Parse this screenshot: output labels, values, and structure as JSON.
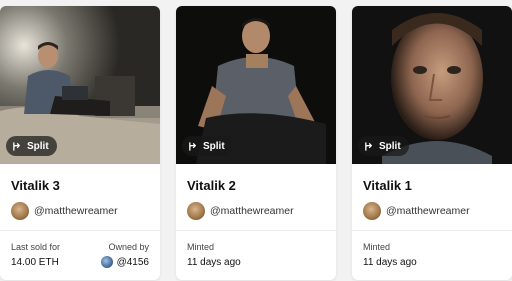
{
  "cards": [
    {
      "title": "Vitalik 3",
      "badge": "Split",
      "creator": "@matthewreamer",
      "left_label": "Last sold for",
      "left_value": "14.00 ETH",
      "right_label": "Owned by",
      "right_value": "@4156"
    },
    {
      "title": "Vitalik 2",
      "badge": "Split",
      "creator": "@matthewreamer",
      "left_label": "Minted",
      "left_value": "11 days ago"
    },
    {
      "title": "Vitalik 1",
      "badge": "Split",
      "creator": "@matthewreamer",
      "left_label": "Minted",
      "left_value": "11 days ago"
    }
  ],
  "colors": {
    "page_bg": "#f2f2f2",
    "card_bg": "#ffffff",
    "badge_bg": "#191919"
  },
  "icons": {
    "badge_icon": "split-icon"
  }
}
